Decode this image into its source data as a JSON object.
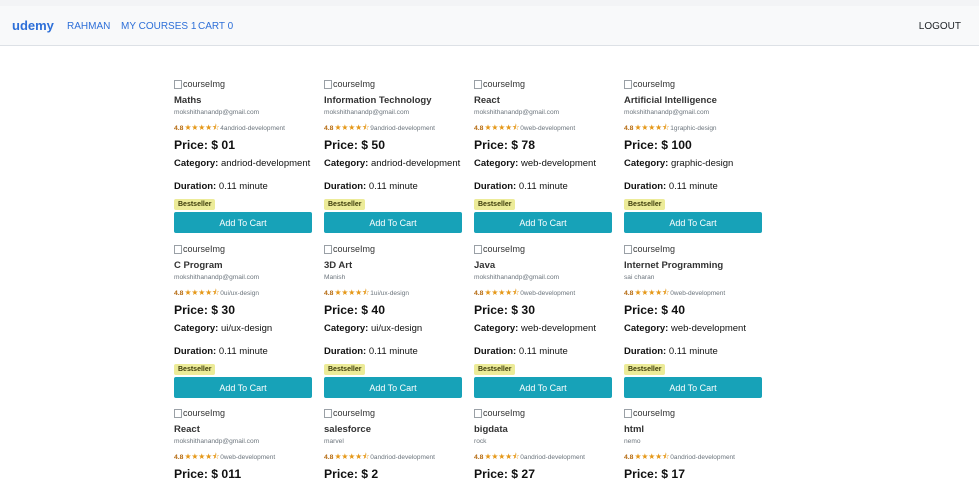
{
  "nav": {
    "brand": "udemy",
    "links": [
      "RAHMAN",
      "MY COURSES 1",
      "CART 0"
    ],
    "logout": "LOGOUT"
  },
  "img_alt": "courseImg",
  "labels": {
    "price": "Price:",
    "category": "Category:",
    "duration": "Duration:",
    "badge": "Bestseller",
    "button": "Add To Cart"
  },
  "courses": [
    {
      "title": "Maths",
      "author": "mokshithanandp@gmail.com",
      "rating": "4.8",
      "stars": "★★★★⯪",
      "count": "4andriod-development",
      "price": "$ 01",
      "category": "andriod-development",
      "duration": "0.11 minute"
    },
    {
      "title": "Information Technology",
      "author": "mokshithanandp@gmail.com",
      "rating": "4.8",
      "stars": "★★★★⯪",
      "count": "9andriod-development",
      "price": "$ 50",
      "category": "andriod-development",
      "duration": "0.11 minute"
    },
    {
      "title": "React",
      "author": "mokshithanandp@gmail.com",
      "rating": "4.8",
      "stars": "★★★★⯪",
      "count": "0web-development",
      "price": "$ 78",
      "category": "web-development",
      "duration": "0.11 minute"
    },
    {
      "title": "Artificial Intelligence",
      "author": "mokshithanandp@gmail.com",
      "rating": "4.8",
      "stars": "★★★★⯪",
      "count": "1graphic-design",
      "price": "$ 100",
      "category": "graphic-design",
      "duration": "0.11 minute"
    },
    {
      "title": "C Program",
      "author": "mokshithanandp@gmail.com",
      "rating": "4.8",
      "stars": "★★★★⯪",
      "count": "0ui/ux-design",
      "price": "$ 30",
      "category": "ui/ux-design",
      "duration": "0.11 minute"
    },
    {
      "title": "3D Art",
      "author": "Manish",
      "rating": "4.8",
      "stars": "★★★★⯪",
      "count": "1ui/ux-design",
      "price": "$ 40",
      "category": "ui/ux-design",
      "duration": "0.11 minute"
    },
    {
      "title": "Java",
      "author": "mokshithanandp@gmail.com",
      "rating": "4.8",
      "stars": "★★★★⯪",
      "count": "0web-development",
      "price": "$ 30",
      "category": "web-development",
      "duration": "0.11 minute"
    },
    {
      "title": "Internet Programming",
      "author": "sai charan",
      "rating": "4.8",
      "stars": "★★★★⯪",
      "count": "0web-development",
      "price": "$ 40",
      "category": "web-development",
      "duration": "0.11 minute"
    },
    {
      "title": "React",
      "author": "mokshithanandp@gmail.com",
      "rating": "4.8",
      "stars": "★★★★⯪",
      "count": "0web-development",
      "price": "$ 011"
    },
    {
      "title": "salesforce",
      "author": "marvel",
      "rating": "4.8",
      "stars": "★★★★⯪",
      "count": "0andriod-development",
      "price": "$ 2"
    },
    {
      "title": "bigdata",
      "author": "rock",
      "rating": "4.8",
      "stars": "★★★★⯪",
      "count": "0andriod-development",
      "price": "$ 27"
    },
    {
      "title": "html",
      "author": "nemo",
      "rating": "4.8",
      "stars": "★★★★⯪",
      "count": "0andriod-development",
      "price": "$ 17"
    }
  ]
}
